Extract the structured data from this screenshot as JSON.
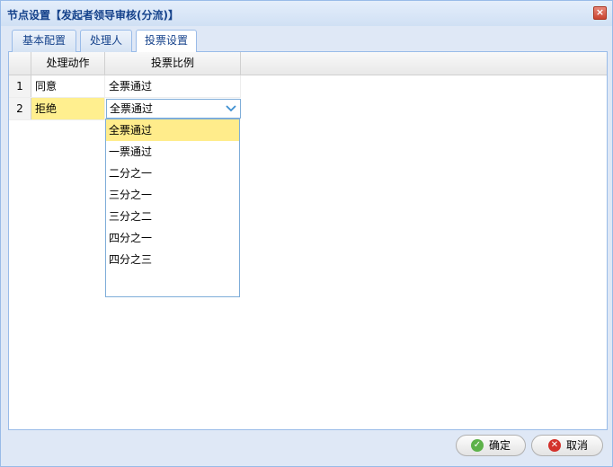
{
  "window": {
    "title": "节点设置【发起者领导审核(分流)】",
    "close_glyph": "×"
  },
  "tabs": [
    {
      "label": "基本配置"
    },
    {
      "label": "处理人"
    },
    {
      "label": "投票设置"
    }
  ],
  "grid": {
    "columns": [
      {
        "label": "处理动作"
      },
      {
        "label": "投票比例"
      }
    ],
    "rows": [
      {
        "num": "1",
        "action": "同意",
        "ratio": "全票通过"
      },
      {
        "num": "2",
        "action": "拒绝",
        "ratio": "全票通过"
      }
    ]
  },
  "dropdown": {
    "options": [
      "全票通过",
      "一票通过",
      "二分之一",
      "三分之一",
      "三分之二",
      "四分之一",
      "四分之三"
    ],
    "selected": "全票通过"
  },
  "buttons": {
    "ok_label": "确定",
    "cancel_label": "取消"
  },
  "icons": {
    "ok": "check-icon",
    "cancel": "cancel-icon",
    "arrow": "chevron-down-icon"
  }
}
